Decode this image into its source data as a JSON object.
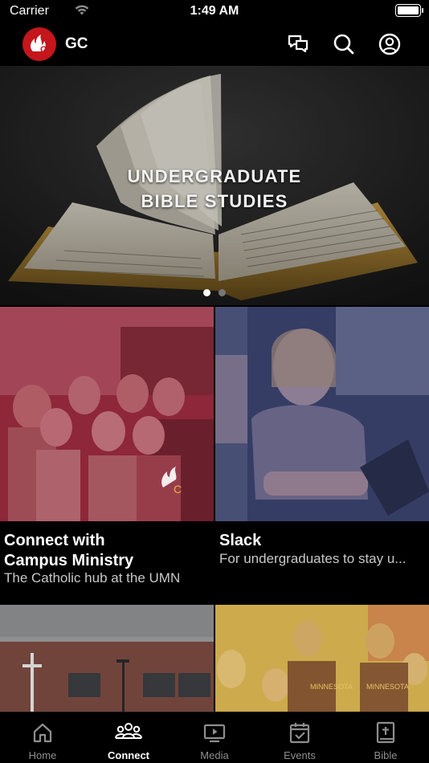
{
  "status_bar": {
    "carrier": "Carrier",
    "time": "1:49 AM",
    "battery_level": 1.0
  },
  "header": {
    "app_name": "GC",
    "logo_letter": "C",
    "icons": [
      "messages-icon",
      "search-icon",
      "profile-icon"
    ]
  },
  "hero": {
    "title_line1": "UNDERGRADUATE",
    "title_line2": "BIBLE STUDIES",
    "page_count": 2,
    "active_page": 1
  },
  "cards": [
    {
      "title_line1": "Connect with",
      "title_line2": "Campus Ministry",
      "subtitle": "The Catholic hub at the UMN"
    },
    {
      "title_line1": "Slack",
      "subtitle": "For undergraduates to stay u..."
    }
  ],
  "tabs": [
    {
      "label": "Home",
      "icon": "home-icon"
    },
    {
      "label": "Connect",
      "icon": "group-icon"
    },
    {
      "label": "Media",
      "icon": "tv-icon"
    },
    {
      "label": "Events",
      "icon": "calendar-icon"
    },
    {
      "label": "Bible",
      "icon": "bible-icon"
    }
  ],
  "active_tab": "Connect",
  "colors": {
    "brand_red": "#c4161c",
    "card1_tint": "#9c2136",
    "card2_tint": "#37406a",
    "card4_tint": "#d8b64a",
    "active_tab": "#ffffff",
    "inactive_tab": "#8e8e8e"
  }
}
